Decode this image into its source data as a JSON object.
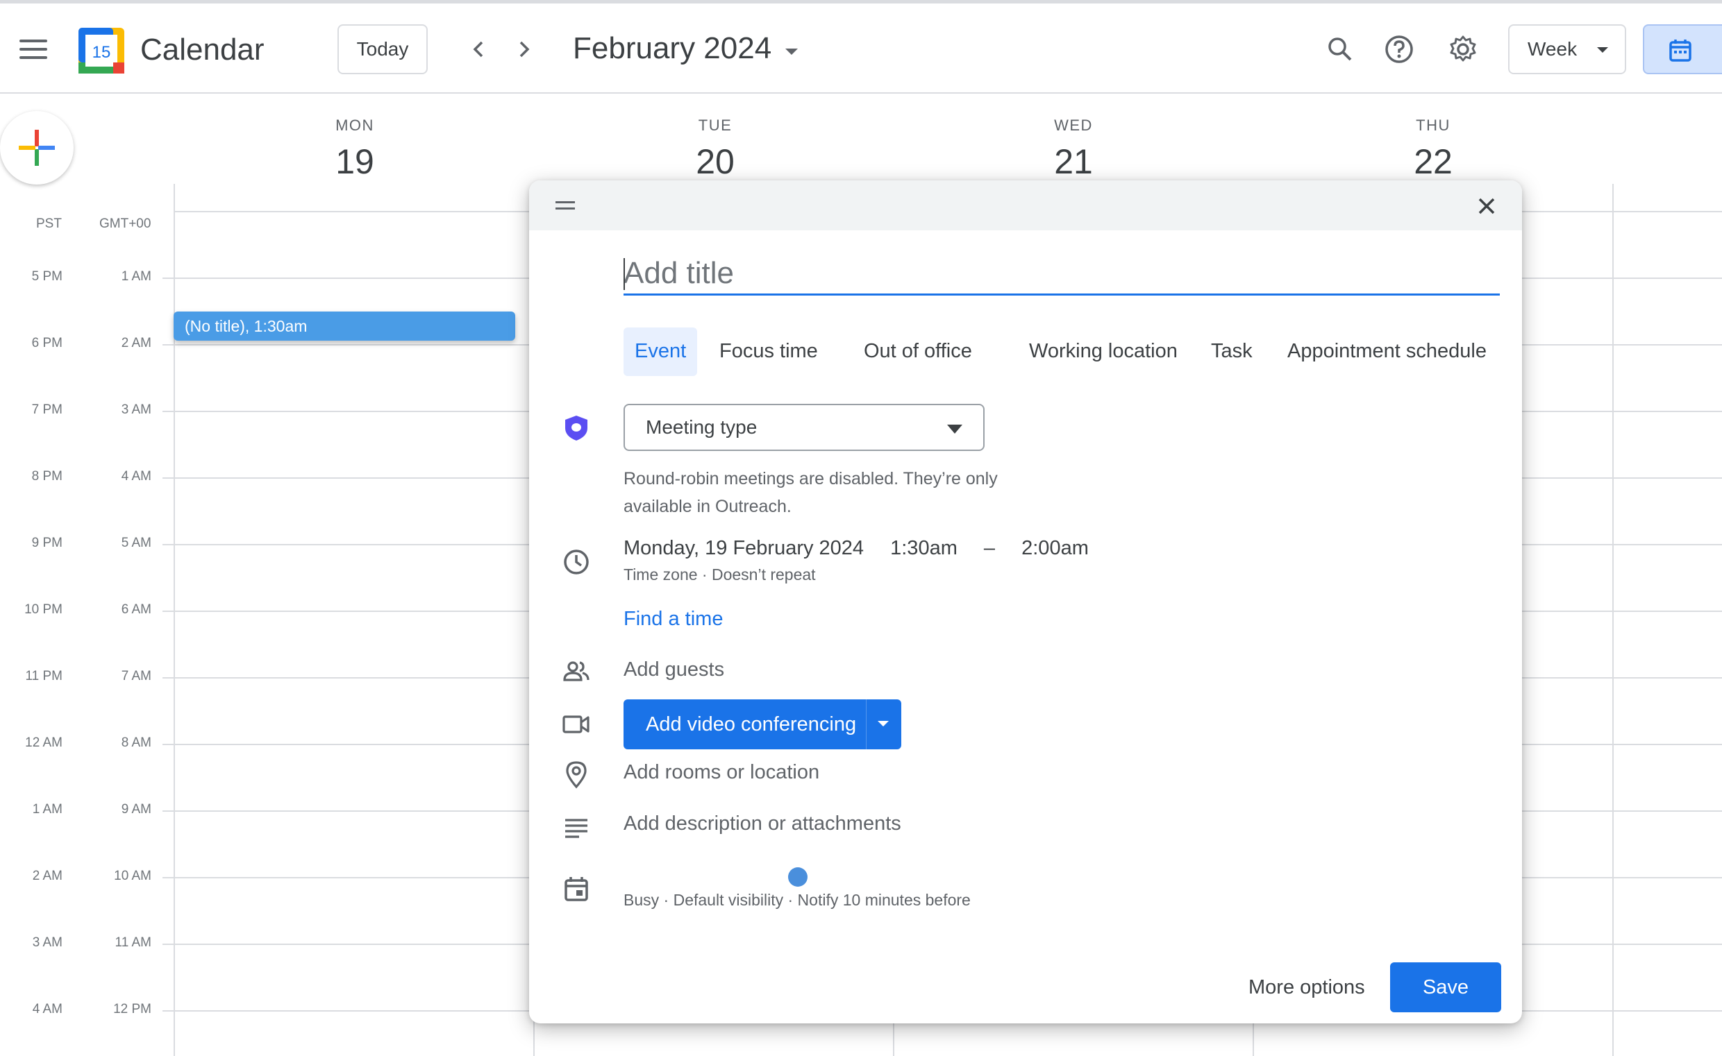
{
  "header": {
    "app_title": "Calendar",
    "logo_day": "15",
    "today_label": "Today",
    "month_title": "February 2024",
    "view_label": "Week"
  },
  "days": [
    {
      "name": "MON",
      "num": "19"
    },
    {
      "name": "TUE",
      "num": "20"
    },
    {
      "name": "WED",
      "num": "21"
    },
    {
      "name": "THU",
      "num": "22"
    }
  ],
  "timezones": {
    "primary": "PST",
    "secondary": "GMT+00"
  },
  "times": {
    "primary": [
      "5 PM",
      "6 PM",
      "7 PM",
      "8 PM",
      "9 PM",
      "10 PM",
      "11 PM",
      "12 AM",
      "1 AM",
      "2 AM",
      "3 AM",
      "4 AM"
    ],
    "secondary": [
      "1 AM",
      "2 AM",
      "3 AM",
      "4 AM",
      "5 AM",
      "6 AM",
      "7 AM",
      "8 AM",
      "9 AM",
      "10 AM",
      "11 AM",
      "12 PM"
    ]
  },
  "event_chip": {
    "label": "(No title), 1:30am",
    "color": "#4a9ce6"
  },
  "dialog": {
    "title_placeholder": "Add title",
    "tabs": [
      "Event",
      "Focus time",
      "Out of office",
      "Working location",
      "Task",
      "Appointment schedule"
    ],
    "meeting_type": "Meeting type",
    "note": "Round-robin meetings are disabled. They’re only available in Outreach.",
    "date": "Monday, 19 February 2024",
    "start_time": "1:30am",
    "dash": "–",
    "end_time": "2:00am",
    "timezone_label": "Time zone",
    "repeat_label": "Doesn’t repeat",
    "find_time": "Find a time",
    "add_guests": "Add guests",
    "video_conf": "Add video conferencing",
    "add_location": "Add rooms or location",
    "add_description": "Add description or attachments",
    "busy": "Busy",
    "visibility": "Default visibility",
    "notify": "Notify 10 minutes before",
    "more_options": "More options",
    "save": "Save"
  },
  "colors": {
    "accent": "#1a73e8",
    "tab_active_bg": "#e8f0fe",
    "grid": "#dadce0"
  },
  "icons": [
    "menu-icon",
    "calendar-logo-icon",
    "chevron-left-icon",
    "chevron-right-icon",
    "search-icon",
    "help-icon",
    "gear-icon",
    "calendar-view-icon",
    "plus-icon",
    "drag-handle-icon",
    "close-icon",
    "outreach-shield-icon",
    "clock-icon",
    "people-icon",
    "video-icon",
    "location-pin-icon",
    "notes-icon",
    "calendar-event-icon"
  ]
}
